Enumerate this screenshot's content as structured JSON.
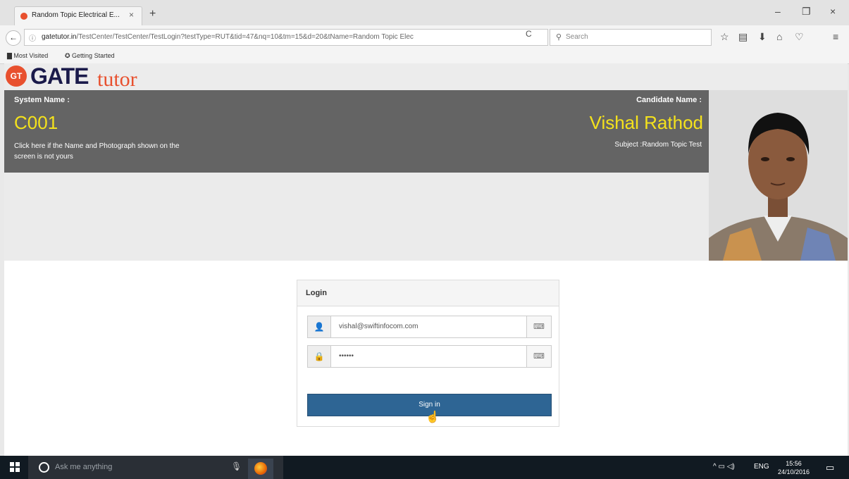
{
  "browser": {
    "tab_title": "Random Topic Electrical E...",
    "tab_close": "×",
    "new_tab": "+",
    "window_controls": {
      "minimize": "–",
      "restore": "❐",
      "close": "×"
    },
    "back": "←",
    "info_icon": "ⓘ",
    "url_host": "gatetutor.in",
    "url_path": "/TestCenter/TestCenter/TestLogin?testType=RUT&tid=47&nq=10&tm=15&d=20&tName=Random Topic Elec",
    "reload": "C",
    "search_icon": "⚲",
    "search_placeholder": "Search",
    "toolbar_icons": [
      "star-icon",
      "reading-list-icon",
      "download-icon",
      "home-icon",
      "pocket-icon",
      "menu-icon"
    ],
    "toolbar_glyphs": [
      "☆",
      "▤",
      "⬇",
      "⌂",
      "♡",
      "≡"
    ],
    "bookmarks": [
      "Most Visited",
      "Getting Started"
    ]
  },
  "page": {
    "logo_badge": "GT",
    "logo_gate": "GATE",
    "logo_tutor": "tutor",
    "system_label": "System Name :",
    "system_value": "C001",
    "disclaimer": "Click here if the Name and Photograph shown on the screen is not yours",
    "candidate_label": "Candidate Name :",
    "candidate_value": "Vishal Rathod",
    "subject": "Subject :Random Topic Test",
    "login": {
      "title": "Login",
      "username_icon": "👤",
      "username_value": "vishal@swiftinfocom.com",
      "password_icon": "🔒",
      "password_value": "••••••",
      "keyboard_icon": "⌨",
      "signin_label": "Sign in"
    }
  },
  "taskbar": {
    "search_placeholder": "Ask me anything",
    "mic": "🎙",
    "tray_lang": "ENG",
    "tray_icons": "^  ▭  ◁)",
    "time": "15:56",
    "date": "24/10/2016",
    "notify": "▭"
  },
  "colors": {
    "header_bg": "#646464",
    "highlight": "#f4e21c",
    "button": "#2e6594",
    "logo_orange": "#e8502e"
  }
}
